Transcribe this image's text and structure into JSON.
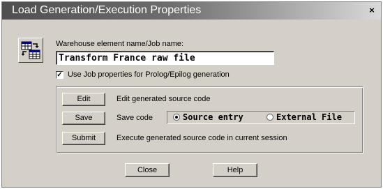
{
  "window": {
    "title": "Load Generation/Execution Properties",
    "close_glyph": "×"
  },
  "icons": {
    "app": "table-transform-icon"
  },
  "warehouse": {
    "label": "Warehouse element name/Job name:",
    "value": "Transform France raw file"
  },
  "use_job_properties": {
    "checked": true,
    "check_glyph": "✓",
    "label": "Use Job properties for Prolog/Epilog generation"
  },
  "actions": {
    "edit": {
      "button": "Edit",
      "description": "Edit generated source code"
    },
    "save": {
      "button": "Save",
      "description": "Save code"
    },
    "submit": {
      "button": "Submit",
      "description": "Execute generated source code in current session"
    }
  },
  "save_target": {
    "options": [
      {
        "label": "Source entry",
        "selected": true
      },
      {
        "label": "External File",
        "selected": false
      }
    ]
  },
  "footer": {
    "close": "Close",
    "help": "Help"
  }
}
